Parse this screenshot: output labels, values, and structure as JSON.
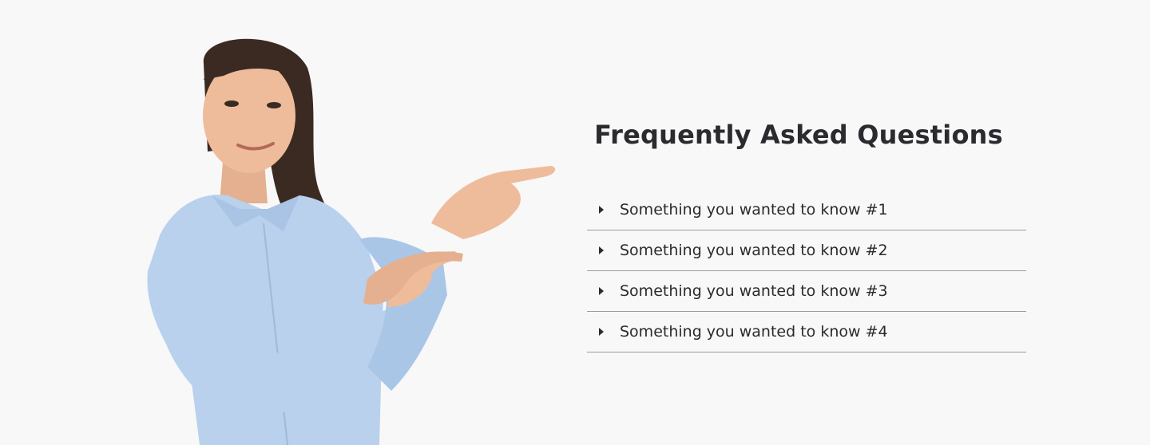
{
  "faq": {
    "title": "Frequently Asked Questions",
    "items": [
      {
        "icon": "caret-right-icon",
        "question": "Something you wanted to know #1"
      },
      {
        "icon": "caret-right-icon",
        "question": "Something you wanted to know #2"
      },
      {
        "icon": "caret-right-icon",
        "question": "Something you wanted to know #3"
      },
      {
        "icon": "caret-right-icon",
        "question": "Something you wanted to know #4"
      }
    ]
  },
  "colors": {
    "background": "#f8f8f9",
    "text": "#2b2b2f",
    "divider": "#9c9c9c",
    "shirt": "#b9d1ec"
  }
}
